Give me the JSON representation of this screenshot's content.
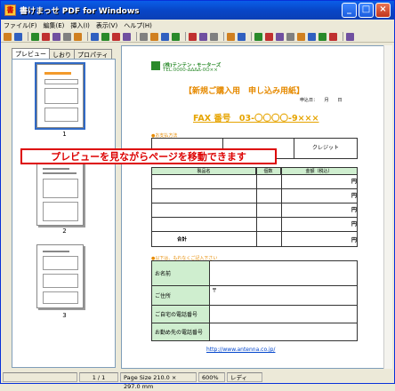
{
  "window": {
    "title": "書けまっせ PDF for Windows",
    "icon_glyph": "書",
    "minimize": "_",
    "maximize": "□",
    "close": "×"
  },
  "menu": [
    "ファイル(F)",
    "編集(E)",
    "挿入(I)",
    "表示(V)",
    "ヘルプ(H)"
  ],
  "toolbar_icons": [
    "open-icon",
    "new-icon",
    "save-icon",
    "save-as-icon",
    "save2-icon",
    "export-icon",
    "delete-icon",
    "print-icon",
    "page-first-icon",
    "page-prev-icon",
    "page-next-icon",
    "page-last-icon",
    "zoom-in-icon",
    "zoom-out-icon",
    "fit-icon",
    "fit-width-icon",
    "undo-icon",
    "redo-icon",
    "cut-icon",
    "text-icon",
    "image-icon",
    "rect-icon",
    "fill-icon",
    "circle-icon",
    "line-icon",
    "minus-icon",
    "check-icon",
    "stamp-icon",
    "help-icon"
  ],
  "colors": {
    "accent": "#316ac5",
    "title_bar": "#0846c8",
    "form_orange": "#e68a00",
    "header_green": "#cfeecf",
    "banner_red": "#dd0000"
  },
  "left_panel": {
    "tabs": [
      "プレビュー",
      "しおり",
      "プロパティ"
    ],
    "pages": [
      {
        "number": "1"
      },
      {
        "number": "2"
      },
      {
        "number": "3"
      }
    ]
  },
  "document": {
    "company_line1": "(株)テンテン・モーターズ",
    "company_line2": "TEL:0000-ΔΔΔΔ-0O××",
    "title": "【新規ご購入用　申し込み用紙】",
    "date": "申込日：　　月　　日",
    "fax": "FAX 番号　03-〇〇〇〇-9×××",
    "payment_note": "●お支払方法",
    "payment_cells": [
      "",
      "",
      "クレジット"
    ],
    "items_header": [
      "製品名",
      "個数",
      "金額（税込）"
    ],
    "yen": "円",
    "total": "合計",
    "info_note": "●以下は、もれなくご記入下さい",
    "info_labels": [
      "お名前",
      "ご住所",
      "ご自宅の電話番号",
      "お勤め先の電話番号"
    ],
    "postal_mark": "〒",
    "url": "http://www.antenna.co.jp/"
  },
  "banner": {
    "text": "プレビューを見ながらページを移動できます"
  },
  "status": {
    "page": "1 / 1",
    "size": "Page Size 210.0 × 297.0 mm",
    "zoom": "600%",
    "ready": "レディ"
  }
}
